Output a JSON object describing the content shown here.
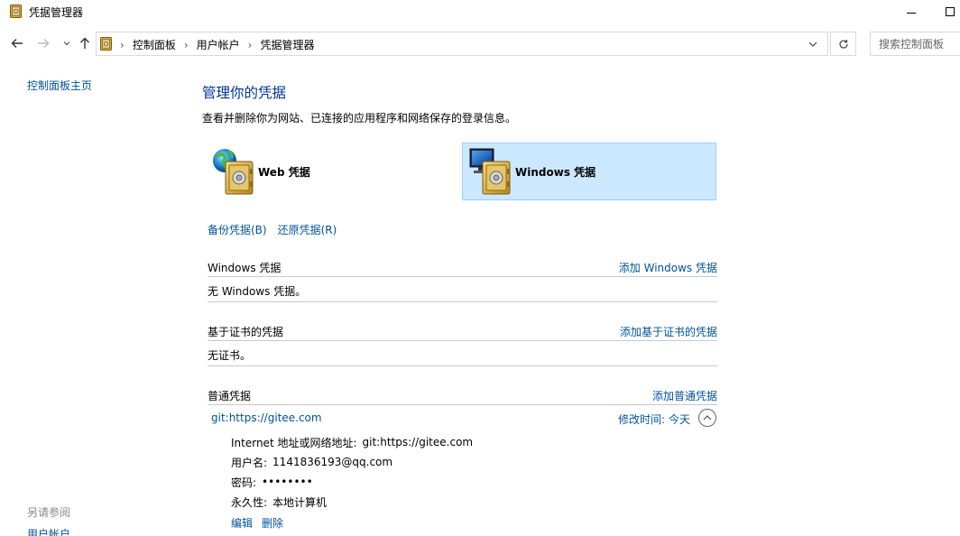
{
  "window": {
    "title": "凭据管理器"
  },
  "nav": {
    "breadcrumbs": [
      "控制面板",
      "用户帐户",
      "凭据管理器"
    ],
    "search_placeholder": "搜索控制面板"
  },
  "sidebar": {
    "home": "控制面板主页",
    "see_also": "另请参阅",
    "user_accounts": "用户帐户"
  },
  "main": {
    "title": "管理你的凭据",
    "description": "查看并删除你为网站、已连接的应用程序和网络保存的登录信息。",
    "types": {
      "web": "Web 凭据",
      "windows": "Windows 凭据"
    },
    "backup": "备份凭据(B)",
    "restore": "还原凭据(R)",
    "sections": {
      "windows": {
        "title": "Windows 凭据",
        "add": "添加 Windows 凭据",
        "empty": "无 Windows 凭据。"
      },
      "cert": {
        "title": "基于证书的凭据",
        "add": "添加基于证书的凭据",
        "empty": "无证书。"
      },
      "generic": {
        "title": "普通凭据",
        "add": "添加普通凭据",
        "entry": {
          "name": "git:https://gitee.com",
          "modified_label": "修改时间:",
          "modified_value": "今天",
          "address_label": "Internet 地址或网络地址:",
          "address_value": "git:https://gitee.com",
          "username_label": "用户名:",
          "username_value": "1141836193@qq.com",
          "password_label": "密码:",
          "password_value": "••••••••",
          "persistence_label": "永久性:",
          "persistence_value": "本地计算机",
          "edit": "编辑",
          "delete": "删除"
        }
      }
    }
  },
  "colors": {
    "link": "#00529b",
    "title": "#003399",
    "selected_bg": "#cce8ff",
    "selected_border": "#99d1ff"
  }
}
